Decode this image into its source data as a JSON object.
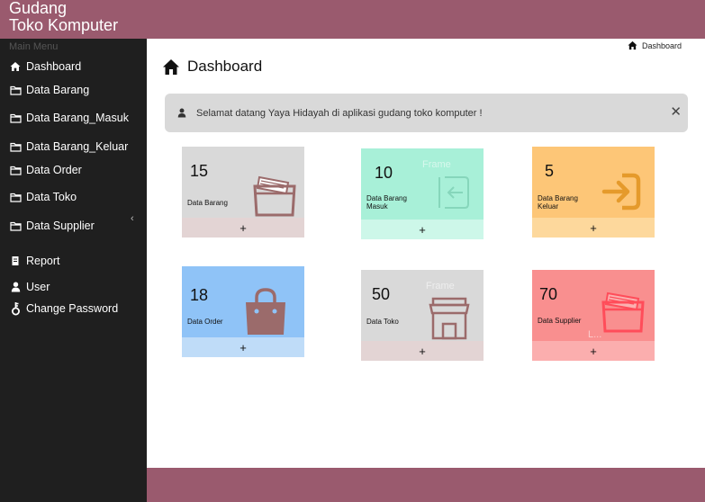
{
  "brand": {
    "line1": "Gudang",
    "line2": "Toko Komputer"
  },
  "sidebar": {
    "heading": "Main Menu",
    "items": [
      {
        "label": "Dashboard",
        "icon": "home-icon"
      },
      {
        "label": "Data Barang",
        "icon": "folder-icon"
      },
      {
        "label": "Data Barang_Masuk",
        "icon": "folder-icon"
      },
      {
        "label": "Data Barang_Keluar",
        "icon": "folder-icon"
      },
      {
        "label": "Data Order",
        "icon": "folder-icon"
      },
      {
        "label": "Data Toko",
        "icon": "folder-icon"
      },
      {
        "label": "Data Supplier",
        "icon": "folder-icon"
      },
      {
        "label": "Report",
        "icon": "report-icon"
      },
      {
        "label": "User",
        "icon": "user-icon"
      },
      {
        "label": "Change Password",
        "icon": "key-icon"
      }
    ],
    "collapse_glyph": "‹"
  },
  "breadcrumb": {
    "label": "Dashboard"
  },
  "page": {
    "title": "Dashboard"
  },
  "alert": {
    "message": "Selamat datang Yaya Hidayah di aplikasi gudang toko komputer !",
    "close_glyph": "✕"
  },
  "cards": [
    {
      "value": "15",
      "label": "Data Barang",
      "plus": "+",
      "color": "#d9d9d9",
      "footer_color": "#e3d4d4",
      "icon": "folder-open-icon"
    },
    {
      "value": "10",
      "label": "Data Barang Masuk",
      "plus": "+",
      "color": "#a8f0d8",
      "footer_color": "#cdf7e9",
      "icon": "sign-in-icon",
      "ghost": "Frame"
    },
    {
      "value": "5",
      "label": "Data Barang Keluar",
      "plus": "+",
      "color": "#fdc677",
      "footer_color": "#fdd89c",
      "icon": "sign-out-icon"
    },
    {
      "value": "18",
      "label": "Data Order",
      "plus": "+",
      "color": "#8fc3f7",
      "footer_color": "#bfdcf8",
      "icon": "shopping-bag-icon"
    },
    {
      "value": "50",
      "label": "Data Toko",
      "plus": "+",
      "color": "#d9d9d9",
      "footer_color": "#e3d4d4",
      "icon": "store-icon",
      "ghost": "Frame"
    },
    {
      "value": "70",
      "label": "Data Supplier",
      "plus": "+",
      "color": "#f98f8f",
      "footer_color": "#fbaeae",
      "icon": "folder-open-icon",
      "ghost": "L..."
    }
  ]
}
